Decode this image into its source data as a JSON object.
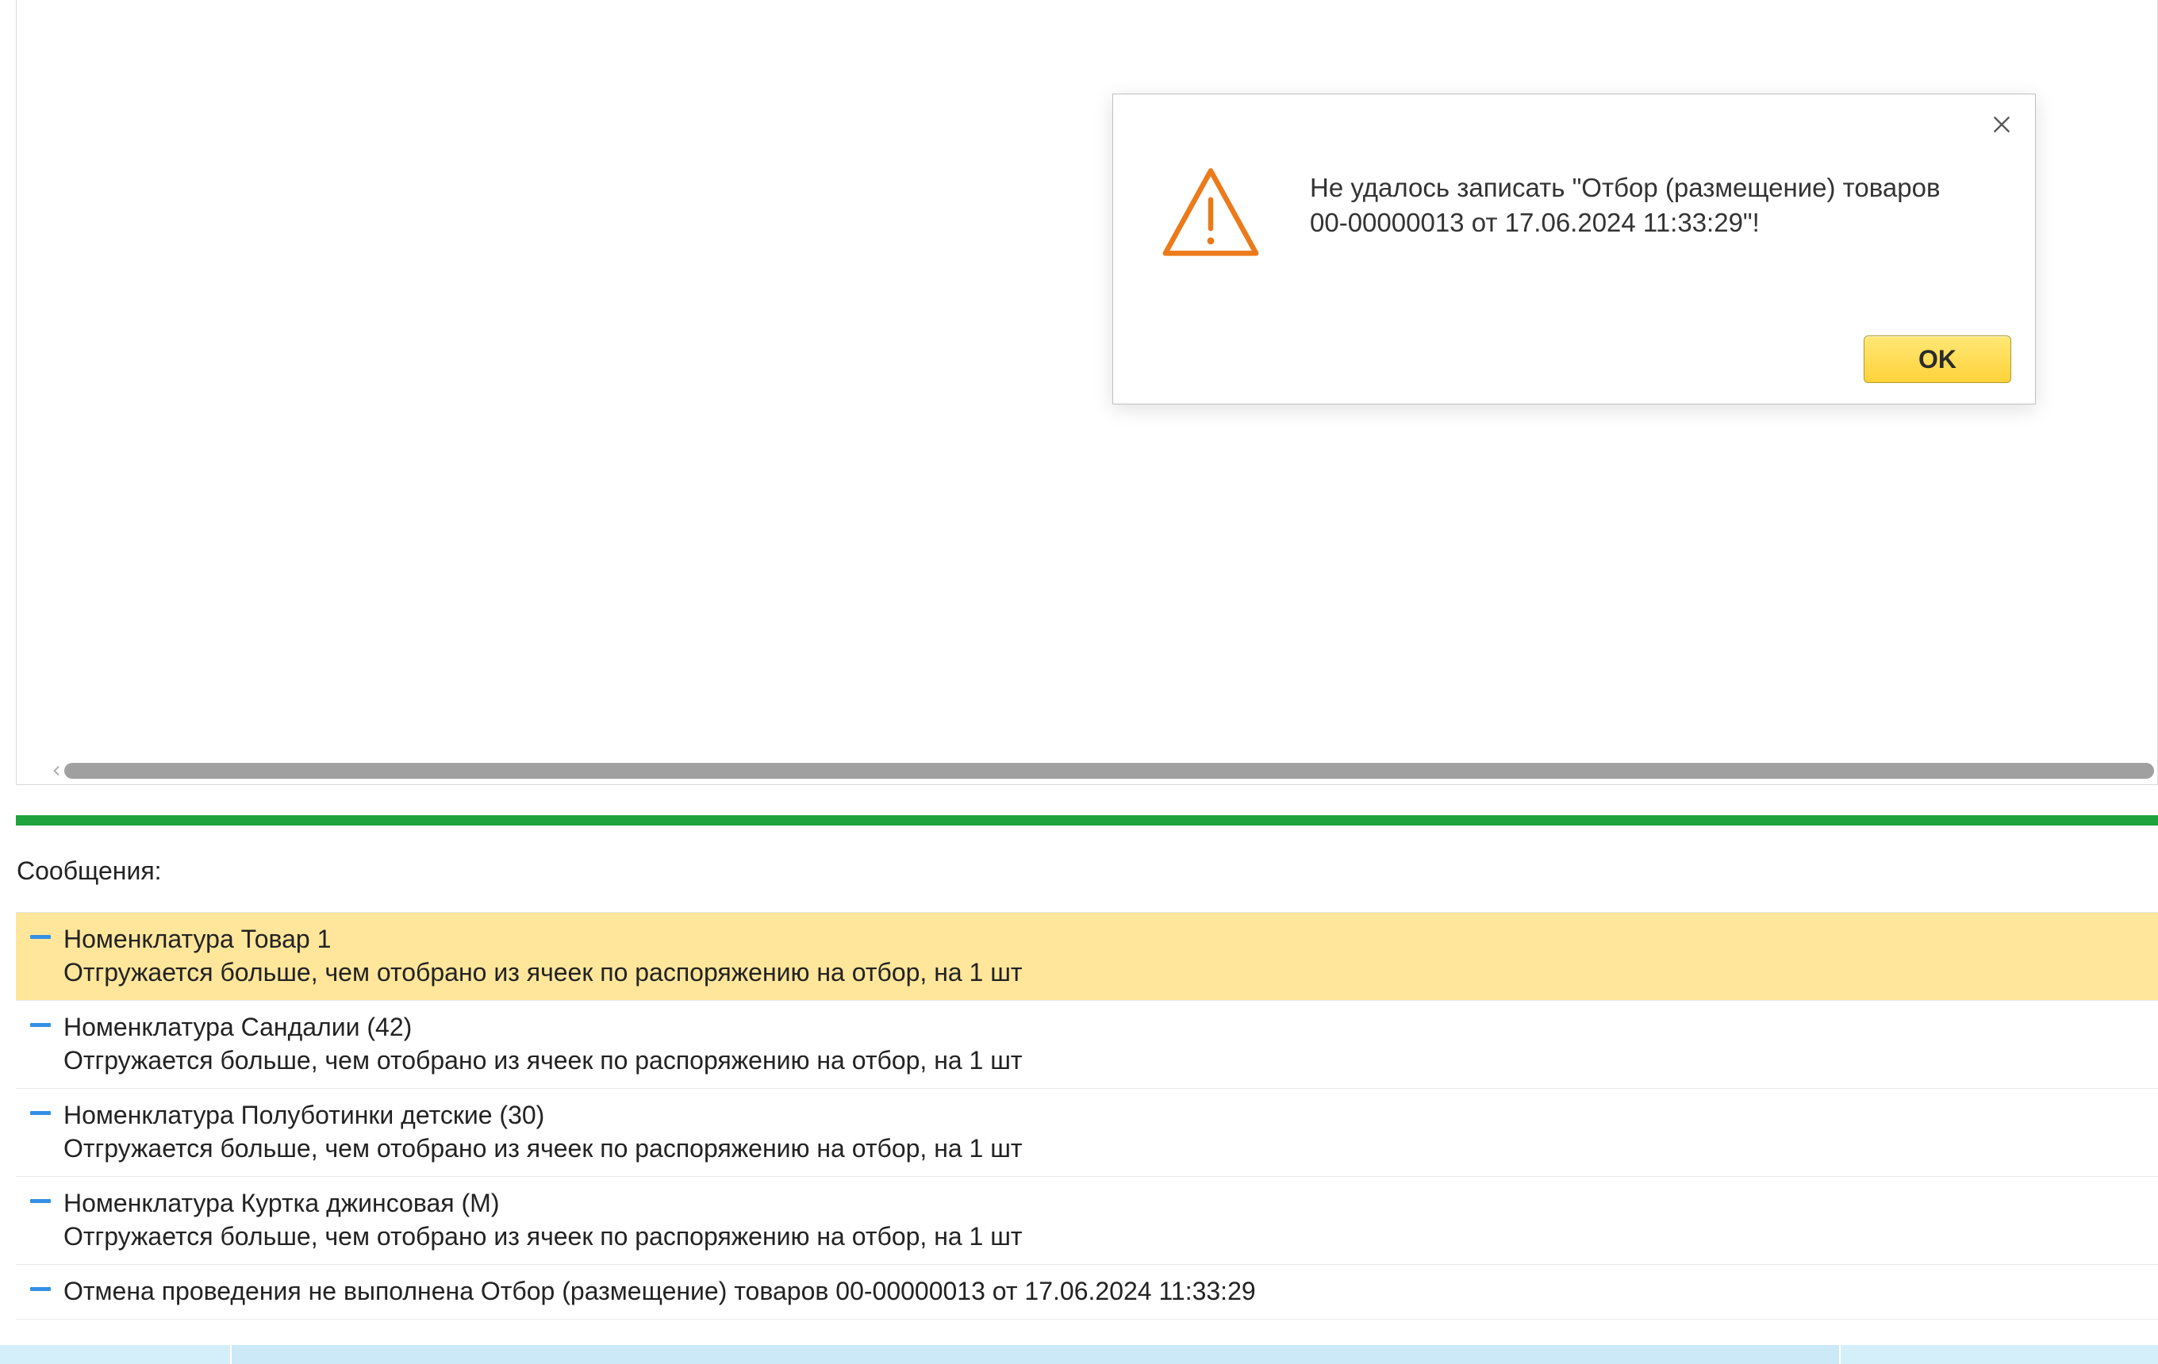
{
  "dialog": {
    "message_line1": "Не удалось записать \"Отбор (размещение) товаров",
    "message_line2": "00-00000013 от 17.06.2024 11:33:29\"!",
    "ok_label": "OK"
  },
  "messages_panel": {
    "title": "Сообщения:"
  },
  "messages": [
    {
      "line1": "Номенклатура Товар 1",
      "line2": "Отгружается больше, чем отобрано из ячеек по распоряжению на отбор, на 1 шт",
      "highlight": true
    },
    {
      "line1": "Номенклатура Сандалии (42)",
      "line2": "Отгружается больше, чем отобрано из ячеек по распоряжению на отбор, на 1 шт",
      "highlight": false
    },
    {
      "line1": "Номенклатура Полуботинки детские (30)",
      "line2": "Отгружается больше, чем отобрано из ячеек по распоряжению на отбор, на 1 шт",
      "highlight": false
    },
    {
      "line1": "Номенклатура Куртка джинсовая (M)",
      "line2": "Отгружается больше, чем отобрано из ячеек по распоряжению на отбор, на 1 шт",
      "highlight": false
    },
    {
      "line1": "Отмена проведения не выполнена Отбор (размещение) товаров 00-00000013 от 17.06.2024 11:33:29",
      "line2": "",
      "highlight": false
    }
  ]
}
